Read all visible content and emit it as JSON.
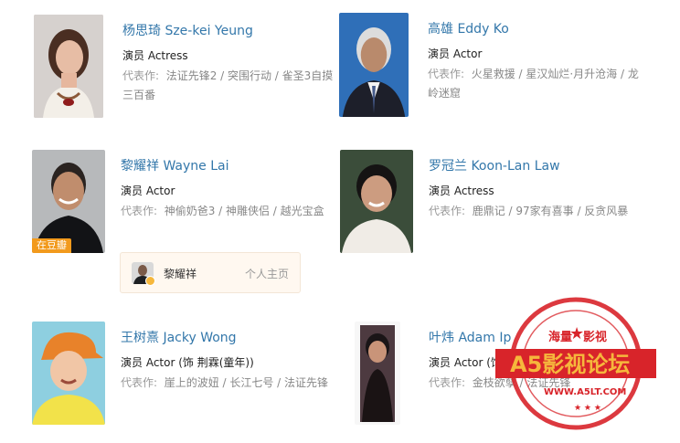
{
  "cast": [
    {
      "name": "杨思琦 Sze-kei Yeung",
      "role": "演员 Actress",
      "works_label": "代表作:",
      "works": "法证先锋2 / 突围行动 / 雀圣3自摸三百番"
    },
    {
      "name": "高雄 Eddy Ko",
      "role": "演员 Actor",
      "works_label": "代表作:",
      "works": "火星救援 / 星汉灿烂·月升沧海 / 龙岭迷窟"
    },
    {
      "name": "黎耀祥 Wayne Lai",
      "role": "演员 Actor",
      "works_label": "代表作:",
      "works": "神偷奶爸3 / 神雕侠侣 / 越光宝盒",
      "badge": "在豆瓣"
    },
    {
      "name": "罗冠兰 Koon-Lan Law",
      "role": "演员 Actress",
      "works_label": "代表作:",
      "works": "鹿鼎记 / 97家有喜事 / 反贪风暴"
    },
    {
      "name": "王树熹 Jacky Wong",
      "role": "演员 Actor (饰 荆霖(童年))",
      "works_label": "代表作:",
      "works": "崖上的波妞 / 长江七号 / 法证先锋"
    },
    {
      "name": "叶炜 Adam Ip",
      "role": "演员 Actor (饰 天山派弟子)",
      "works_label": "代表作:",
      "works": "金枝欲孽 / 法证先锋"
    }
  ],
  "popover": {
    "name": "黎耀祥",
    "home_link": "个人主页"
  },
  "watermark": {
    "top_left": "海量",
    "top_right": "影视",
    "main": "A5影视论坛",
    "url": "WWW.A5LT.COM",
    "color": "#d8242a",
    "accent": "#f6b73c"
  },
  "colors": {
    "link": "#3377aa",
    "badge": "#f29a1d",
    "muted": "#999999"
  }
}
